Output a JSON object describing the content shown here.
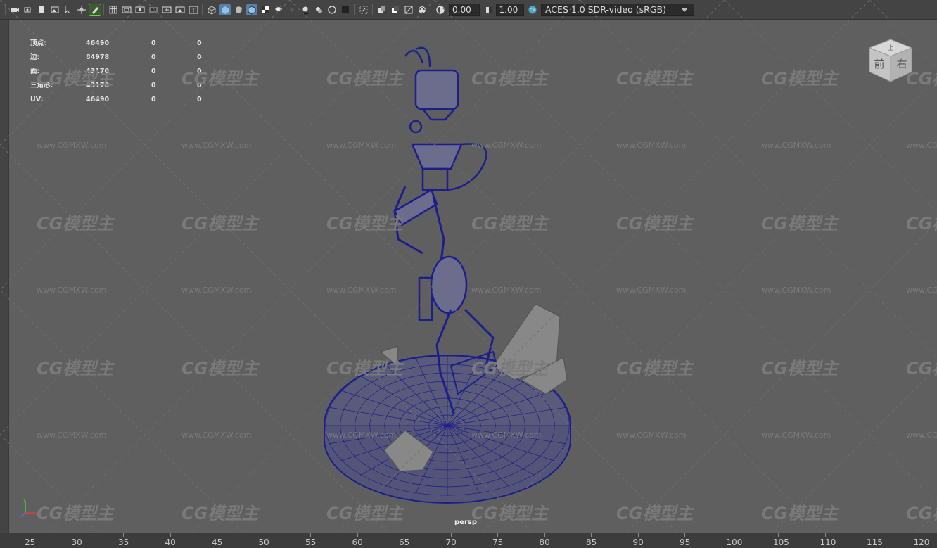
{
  "toolbar": {
    "icons": [
      "camera-icon",
      "camera-attributes-icon",
      "bookmark-icon",
      "image-plane-icon",
      "select-camera-icon",
      "2d-pan-icon",
      "grease-pencil-icon",
      "grid-icon",
      "film-gate-icon",
      "resolution-gate-icon",
      "gate-mask-icon",
      "field-chart-icon",
      "safe-action-icon",
      "safe-title-icon",
      "wireframe-icon",
      "smooth-shade-icon",
      "default-material-icon",
      "wireframe-on-shaded-icon",
      "textured-icon",
      "use-all-lights-icon",
      "shadows-icon",
      "screen-space-ao-icon",
      "motion-blur-icon",
      "multisample-aa-icon",
      "depth-of-field-icon",
      "isolate-select-icon",
      "xray-icon",
      "xray-active-icon",
      "xray-joints-icon",
      "backface-culling-icon",
      "exposure-icon",
      "gamma-icon",
      "color-management-icon"
    ],
    "exposure_value": "0.00",
    "gamma_value": "1.00",
    "view_transform": "ACES 1.0 SDR-video (sRGB)"
  },
  "hud": {
    "rows": [
      {
        "label": "顶点:",
        "v1": "46490",
        "v2": "0",
        "v3": "0"
      },
      {
        "label": "边:",
        "v1": "84978",
        "v2": "0",
        "v3": "0"
      },
      {
        "label": "面:",
        "v1": "43170",
        "v2": "0",
        "v3": "0"
      },
      {
        "label": "三角形:",
        "v1": "43170",
        "v2": "0",
        "v3": "0"
      },
      {
        "label": "UV:",
        "v1": "46490",
        "v2": "0",
        "v3": "0"
      }
    ]
  },
  "viewcube": {
    "top": "上",
    "front": "前",
    "right": "右"
  },
  "viewport": {
    "camera_label": "persp",
    "wireframe_color": "#1b1f8c",
    "background_color": "#5f5f5f"
  },
  "watermark": {
    "logo_text": "CG模型主",
    "url_text": "www.CGMXW.com"
  },
  "timeline": {
    "ticks": [
      "25",
      "30",
      "35",
      "40",
      "45",
      "50",
      "55",
      "60",
      "65",
      "70",
      "75",
      "80",
      "85",
      "90",
      "95",
      "100",
      "105",
      "110",
      "115",
      "120"
    ]
  }
}
